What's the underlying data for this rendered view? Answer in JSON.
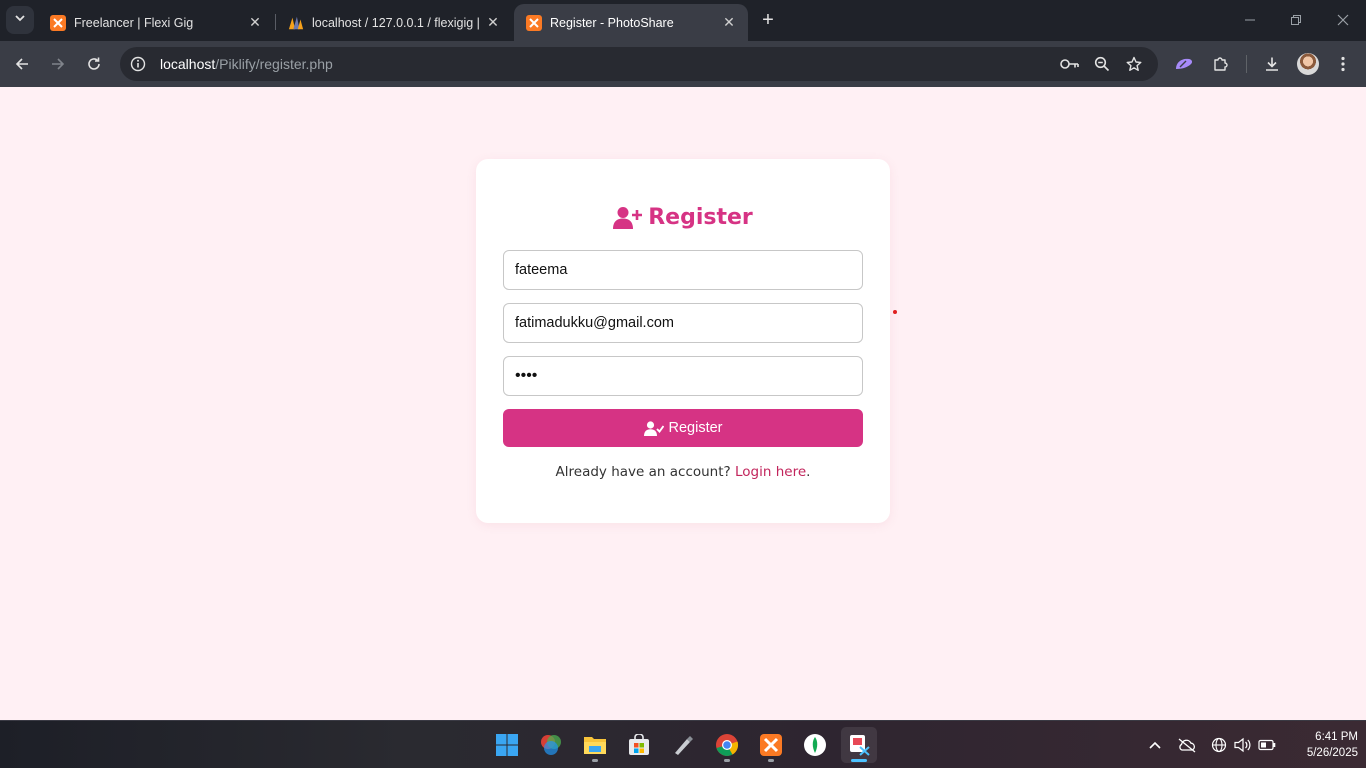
{
  "browser": {
    "tabs": [
      {
        "title": "Freelancer | Flexi Gig",
        "favicon": "xampp-icon",
        "active": false
      },
      {
        "title": "localhost / 127.0.0.1 / flexigig | p",
        "favicon": "phpmyadmin-icon",
        "active": false
      },
      {
        "title": "Register - PhotoShare",
        "favicon": "xampp-icon",
        "active": true
      }
    ],
    "url_host": "localhost",
    "url_path": "/Piklify/register.php"
  },
  "form": {
    "title": "Register",
    "username_value": "fateema",
    "email_value": "fatimadukku@gmail.com",
    "password_value": "••••",
    "submit_label": "Register",
    "login_prompt": "Already have an account?",
    "login_link": "Login here",
    "login_suffix": "."
  },
  "colors": {
    "accent": "#d63384",
    "page_bg": "#fff0f4",
    "card_bg": "#ffffff"
  },
  "taskbar": {
    "apps": [
      "start-icon",
      "color-wheel-icon",
      "file-explorer-icon",
      "microsoft-store-icon",
      "pen-tool-icon",
      "chrome-icon",
      "xampp-icon",
      "mongodb-compass-icon",
      "snipping-tool-icon"
    ],
    "time": "6:41 PM",
    "date": "5/26/2025"
  }
}
